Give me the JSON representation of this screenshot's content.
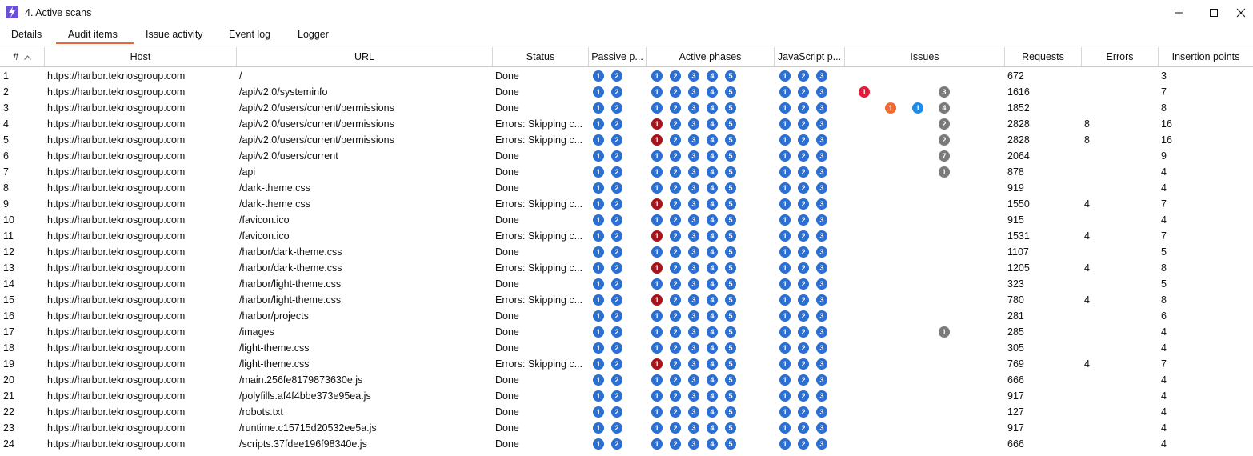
{
  "window": {
    "title": "4. Active scans"
  },
  "tabs": [
    {
      "label": "Details"
    },
    {
      "label": "Audit items"
    },
    {
      "label": "Issue activity"
    },
    {
      "label": "Event log"
    },
    {
      "label": "Logger"
    }
  ],
  "columns": [
    {
      "label": "#",
      "sort": "ascending"
    },
    {
      "label": "Host"
    },
    {
      "label": "URL"
    },
    {
      "label": "Status"
    },
    {
      "label": "Passive p..."
    },
    {
      "label": "Active phases"
    },
    {
      "label": "JavaScript p..."
    },
    {
      "label": "Issues"
    },
    {
      "label": "Requests"
    },
    {
      "label": "Errors"
    },
    {
      "label": "Insertion points"
    }
  ],
  "colors": {
    "phase_blue": "#2a6fd3",
    "phase_error": "#a8141b",
    "issue_high": "#e41b3b",
    "issue_medium": "#f06b33",
    "issue_info": "#1e8ce6",
    "issue_gray": "#7a7a7a",
    "tab_accent": "#e8643c"
  },
  "rows": [
    {
      "num": "1",
      "host": "https://harbor.teknosgroup.com",
      "url": "/",
      "status": "Done",
      "active_error": false,
      "issues": {},
      "requests": "672",
      "errors": "",
      "insertion": "3"
    },
    {
      "num": "2",
      "host": "https://harbor.teknosgroup.com",
      "url": "/api/v2.0/systeminfo",
      "status": "Done",
      "active_error": false,
      "issues": {
        "high": "1",
        "gray": "3"
      },
      "requests": "1616",
      "errors": "",
      "insertion": "7"
    },
    {
      "num": "3",
      "host": "https://harbor.teknosgroup.com",
      "url": "/api/v2.0/users/current/permissions",
      "status": "Done",
      "active_error": false,
      "issues": {
        "medium": "1",
        "info": "1",
        "gray": "4"
      },
      "requests": "1852",
      "errors": "",
      "insertion": "8"
    },
    {
      "num": "4",
      "host": "https://harbor.teknosgroup.com",
      "url": "/api/v2.0/users/current/permissions",
      "status": "Errors: Skipping c...",
      "active_error": true,
      "issues": {
        "gray": "2"
      },
      "requests": "2828",
      "errors": "8",
      "insertion": "16"
    },
    {
      "num": "5",
      "host": "https://harbor.teknosgroup.com",
      "url": "/api/v2.0/users/current/permissions",
      "status": "Errors: Skipping c...",
      "active_error": true,
      "issues": {
        "gray": "2"
      },
      "requests": "2828",
      "errors": "8",
      "insertion": "16"
    },
    {
      "num": "6",
      "host": "https://harbor.teknosgroup.com",
      "url": "/api/v2.0/users/current",
      "status": "Done",
      "active_error": false,
      "issues": {
        "gray": "7"
      },
      "requests": "2064",
      "errors": "",
      "insertion": "9"
    },
    {
      "num": "7",
      "host": "https://harbor.teknosgroup.com",
      "url": "/api",
      "status": "Done",
      "active_error": false,
      "issues": {
        "gray": "1"
      },
      "requests": "878",
      "errors": "",
      "insertion": "4"
    },
    {
      "num": "8",
      "host": "https://harbor.teknosgroup.com",
      "url": "/dark-theme.css",
      "status": "Done",
      "active_error": false,
      "issues": {},
      "requests": "919",
      "errors": "",
      "insertion": "4"
    },
    {
      "num": "9",
      "host": "https://harbor.teknosgroup.com",
      "url": "/dark-theme.css",
      "status": "Errors: Skipping c...",
      "active_error": true,
      "issues": {},
      "requests": "1550",
      "errors": "4",
      "insertion": "7"
    },
    {
      "num": "10",
      "host": "https://harbor.teknosgroup.com",
      "url": "/favicon.ico",
      "status": "Done",
      "active_error": false,
      "issues": {},
      "requests": "915",
      "errors": "",
      "insertion": "4"
    },
    {
      "num": "11",
      "host": "https://harbor.teknosgroup.com",
      "url": "/favicon.ico",
      "status": "Errors: Skipping c...",
      "active_error": true,
      "issues": {},
      "requests": "1531",
      "errors": "4",
      "insertion": "7"
    },
    {
      "num": "12",
      "host": "https://harbor.teknosgroup.com",
      "url": "/harbor/dark-theme.css",
      "status": "Done",
      "active_error": false,
      "issues": {},
      "requests": "1107",
      "errors": "",
      "insertion": "5"
    },
    {
      "num": "13",
      "host": "https://harbor.teknosgroup.com",
      "url": "/harbor/dark-theme.css",
      "status": "Errors: Skipping c...",
      "active_error": true,
      "issues": {},
      "requests": "1205",
      "errors": "4",
      "insertion": "8"
    },
    {
      "num": "14",
      "host": "https://harbor.teknosgroup.com",
      "url": "/harbor/light-theme.css",
      "status": "Done",
      "active_error": false,
      "issues": {},
      "requests": "323",
      "errors": "",
      "insertion": "5"
    },
    {
      "num": "15",
      "host": "https://harbor.teknosgroup.com",
      "url": "/harbor/light-theme.css",
      "status": "Errors: Skipping c...",
      "active_error": true,
      "issues": {},
      "requests": "780",
      "errors": "4",
      "insertion": "8"
    },
    {
      "num": "16",
      "host": "https://harbor.teknosgroup.com",
      "url": "/harbor/projects",
      "status": "Done",
      "active_error": false,
      "issues": {},
      "requests": "281",
      "errors": "",
      "insertion": "6"
    },
    {
      "num": "17",
      "host": "https://harbor.teknosgroup.com",
      "url": "/images",
      "status": "Done",
      "active_error": false,
      "issues": {
        "gray": "1"
      },
      "requests": "285",
      "errors": "",
      "insertion": "4"
    },
    {
      "num": "18",
      "host": "https://harbor.teknosgroup.com",
      "url": "/light-theme.css",
      "status": "Done",
      "active_error": false,
      "issues": {},
      "requests": "305",
      "errors": "",
      "insertion": "4"
    },
    {
      "num": "19",
      "host": "https://harbor.teknosgroup.com",
      "url": "/light-theme.css",
      "status": "Errors: Skipping c...",
      "active_error": true,
      "issues": {},
      "requests": "769",
      "errors": "4",
      "insertion": "7"
    },
    {
      "num": "20",
      "host": "https://harbor.teknosgroup.com",
      "url": "/main.256fe8179873630e.js",
      "status": "Done",
      "active_error": false,
      "issues": {},
      "requests": "666",
      "errors": "",
      "insertion": "4"
    },
    {
      "num": "21",
      "host": "https://harbor.teknosgroup.com",
      "url": "/polyfills.af4f4bbe373e95ea.js",
      "status": "Done",
      "active_error": false,
      "issues": {},
      "requests": "917",
      "errors": "",
      "insertion": "4"
    },
    {
      "num": "22",
      "host": "https://harbor.teknosgroup.com",
      "url": "/robots.txt",
      "status": "Done",
      "active_error": false,
      "issues": {},
      "requests": "127",
      "errors": "",
      "insertion": "4"
    },
    {
      "num": "23",
      "host": "https://harbor.teknosgroup.com",
      "url": "/runtime.c15715d20532ee5a.js",
      "status": "Done",
      "active_error": false,
      "issues": {},
      "requests": "917",
      "errors": "",
      "insertion": "4"
    },
    {
      "num": "24",
      "host": "https://harbor.teknosgroup.com",
      "url": "/scripts.37fdee196f98340e.js",
      "status": "Done",
      "active_error": false,
      "issues": {},
      "requests": "666",
      "errors": "",
      "insertion": "4"
    }
  ]
}
